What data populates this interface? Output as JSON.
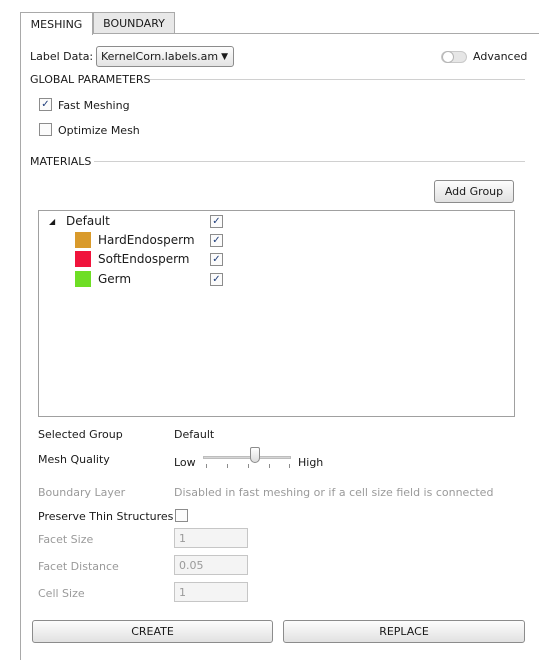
{
  "tabs": [
    {
      "label": "MESHING",
      "active": true
    },
    {
      "label": "BOUNDARY",
      "active": false
    }
  ],
  "label_data": {
    "label": "Label Data:",
    "value": "KernelCorn.labels.am"
  },
  "advanced": {
    "label": "Advanced",
    "on": false
  },
  "global_parameters": {
    "title": "GLOBAL PARAMETERS",
    "fast_meshing": {
      "label": "Fast Meshing",
      "checked": true
    },
    "optimize_mesh": {
      "label": "Optimize Mesh",
      "checked": false
    }
  },
  "materials": {
    "title": "MATERIALS",
    "add_group_label": "Add Group",
    "groups": [
      {
        "name": "Default",
        "checked": true,
        "items": [
          {
            "name": "HardEndosperm",
            "color": "#d99a2b",
            "checked": true
          },
          {
            "name": "SoftEndosperm",
            "color": "#f0143c",
            "checked": true
          },
          {
            "name": "Germ",
            "color": "#6ede25",
            "checked": true
          }
        ]
      }
    ]
  },
  "selected_group": {
    "label": "Selected Group",
    "value": "Default"
  },
  "mesh_quality": {
    "label": "Mesh Quality",
    "low_label": "Low",
    "high_label": "High",
    "level_fraction": 0.6
  },
  "boundary_layer": {
    "label": "Boundary Layer",
    "value": "Disabled in fast meshing or if a cell size field is connected"
  },
  "preserve_thin_structures": {
    "label": "Preserve Thin Structures",
    "checked": false
  },
  "facet_size": {
    "label": "Facet Size",
    "value": "1"
  },
  "facet_distance": {
    "label": "Facet Distance",
    "value": "0.05"
  },
  "cell_size": {
    "label": "Cell Size",
    "value": "1"
  },
  "buttons": {
    "create_label": "CREATE",
    "replace_label": "REPLACE"
  },
  "glyphs": {
    "check": "✓",
    "combo_arrow": "▼",
    "tree_expanded": "◢"
  }
}
